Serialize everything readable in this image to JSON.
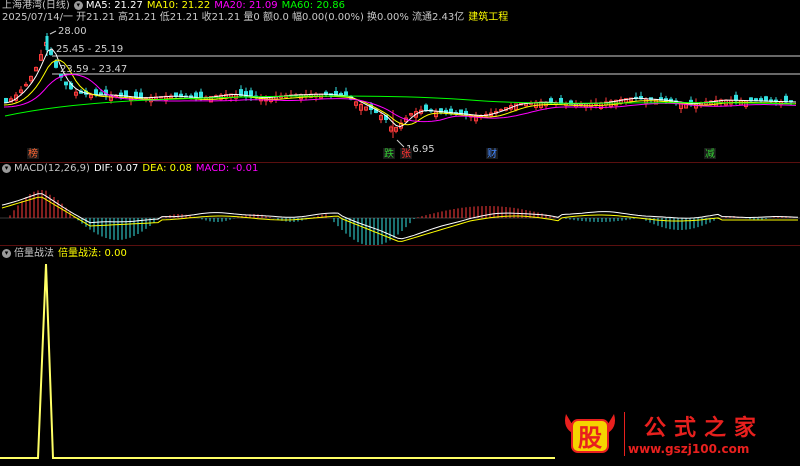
{
  "price_header": {
    "title": "上海港湾(日线)",
    "ma5": "MA5: 21.27",
    "ma10": "MA10: 21.22",
    "ma20": "MA20: 21.09",
    "ma60": "MA60: 20.86",
    "info": "2025/07/14/一 开21.21 高21.21 低21.21 收21.21 量0 额0.0 幅0.00(0.00%) 换0.00% 流通2.43亿",
    "industry": "建筑工程",
    "colors": {
      "ma5": "#ffffff",
      "ma10": "#ffff00",
      "ma20": "#ff00ff",
      "ma60": "#00ff00"
    }
  },
  "price_annotations": {
    "high": "28.00",
    "level_upper": "25.45 - 25.19",
    "level_lower": "23.59 - 23.47",
    "low": "16.95"
  },
  "markers": [
    {
      "text": "榜",
      "color": "#ff6633"
    },
    {
      "text": "跌",
      "color": "#33cc33"
    },
    {
      "text": "张",
      "color": "#ff3333"
    },
    {
      "text": "财",
      "color": "#4488ff"
    },
    {
      "text": "减",
      "color": "#33cc33"
    }
  ],
  "macd_header": {
    "title": "MACD(12,26,9)",
    "dif": "DIF: 0.07",
    "dea": "DEA: 0.08",
    "macd": "MACD: -0.01"
  },
  "volume_header": {
    "title": "倍量战法",
    "value": "倍量战法: 0.00"
  },
  "watermark": {
    "logo": "股",
    "title": "公式之家",
    "url": "www.gszj100.com"
  }
}
